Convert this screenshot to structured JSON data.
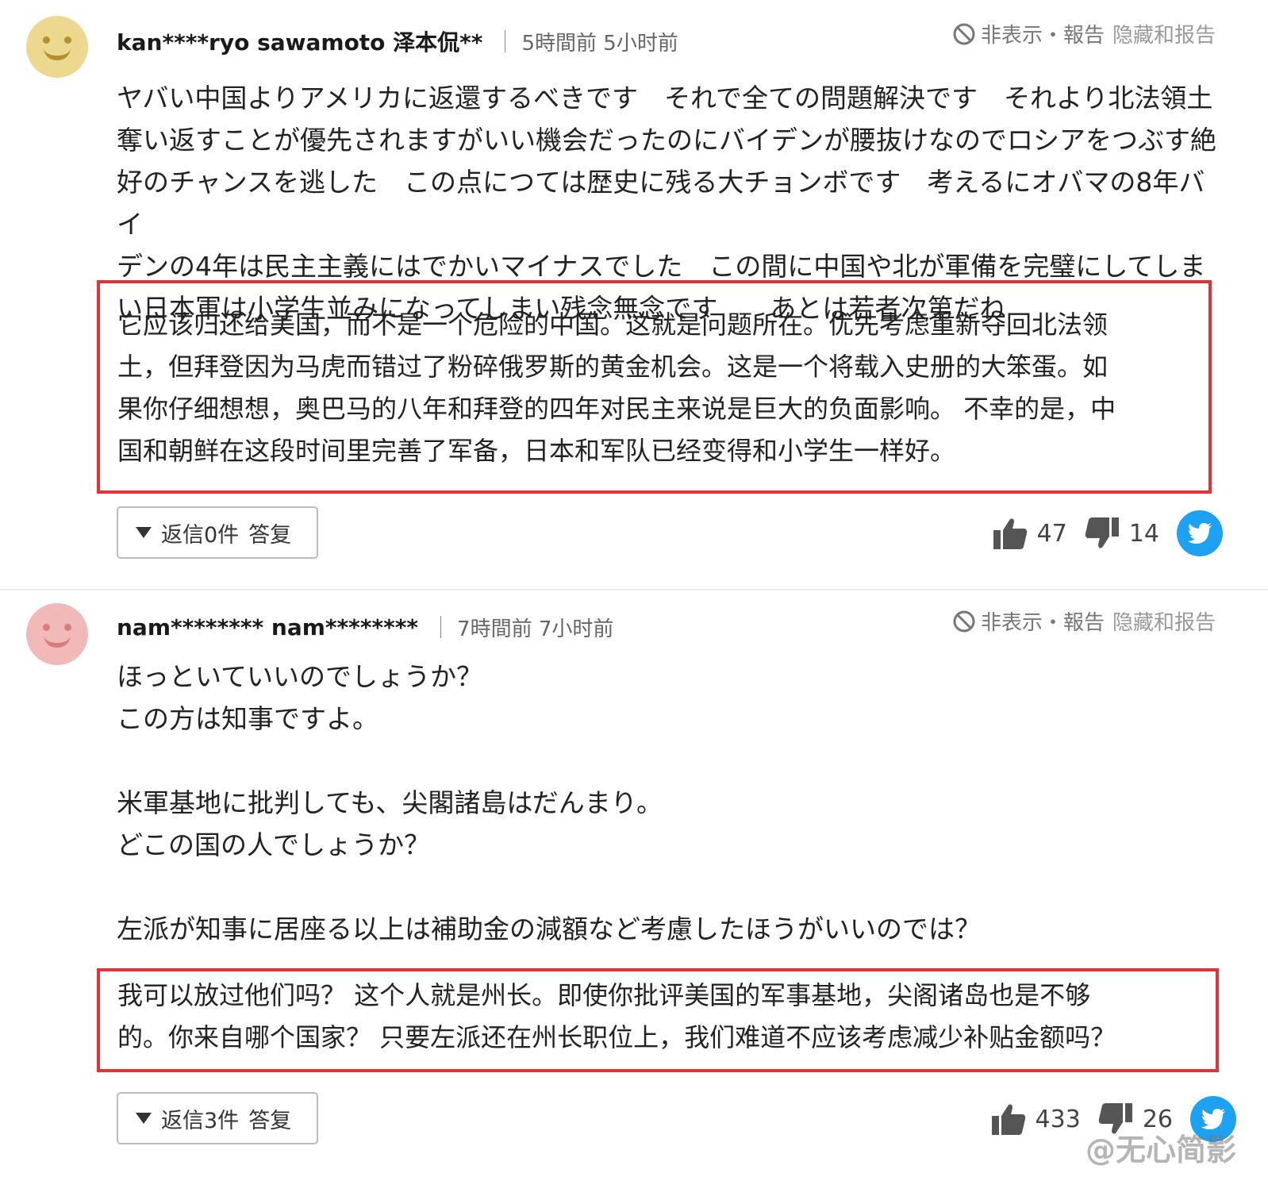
{
  "comments": [
    {
      "username": "kan****ryo sawamoto 泽本侃**",
      "time": "5時間前 5小时前",
      "hide_label": "非表示・報告",
      "hide_label_cn": "隐藏和报告",
      "body_ja": [
        "ヤバい中国よりアメリカに返還するべきです　それで全ての問題解決です　それより北法領土",
        "奪い返すことが優先されますがいい機会だったのにバイデンが腰抜けなのでロシアをつぶす絶",
        "好のチャンスを逃した　この点につては歴史に残る大チョンボです　考えるにオバマの8年バイ",
        "デンの4年は民主主義にはでかいマイナスでした　この間に中国や北が軍備を完璧にしてしま",
        "い日本軍は小学生並みになってしまい残念無念です　　あとは若者次第だね"
      ],
      "translation": [
        "它应该归还给美国，而不是一个危险的中国。这就是问题所在。优先考虑重新夺回北法领",
        "土，但拜登因为马虎而错过了粉碎俄罗斯的黄金机会。这是一个将载入史册的大笨蛋。如",
        "果你仔细想想，奥巴马的八年和拜登的四年对民主来说是巨大的负面影响。 不幸的是，中",
        "国和朝鲜在这段时间里完善了军备，日本和军队已经变得和小学生一样好。"
      ],
      "reply_label": "返信0件",
      "reply_label_cn": "答复",
      "likes": "47",
      "dislikes": "14"
    },
    {
      "username": "nam******** nam********",
      "time": "7時間前 7小时前",
      "hide_label": "非表示・報告",
      "hide_label_cn": "隐藏和报告",
      "body_ja": [
        "ほっといていいのでしょうか？",
        "この方は知事ですよ。",
        "",
        "米軍基地に批判しても、尖閣諸島はだんまり。",
        "どこの国の人でしょうか？",
        "",
        "左派が知事に居座る以上は補助金の減額など考慮したほうがいいのでは？"
      ],
      "translation": [
        "我可以放过他们吗？ 这个人就是州长。即使你批评美国的军事基地，尖阁诸岛也是不够",
        "的。你来自哪个国家？ 只要左派还在州长职位上，我们难道不应该考虑减少补贴金额吗？"
      ],
      "reply_label": "返信3件",
      "reply_label_cn": "答复",
      "likes": "433",
      "dislikes": "26"
    }
  ],
  "watermark": "@无心简影",
  "colors": {
    "highlight_border": "#e53035",
    "twitter": "#1da1f2"
  },
  "icons": [
    "smiley-avatar-icon",
    "block-icon",
    "thumbs-up-icon",
    "thumbs-down-icon",
    "twitter-icon",
    "caret-down-icon"
  ]
}
